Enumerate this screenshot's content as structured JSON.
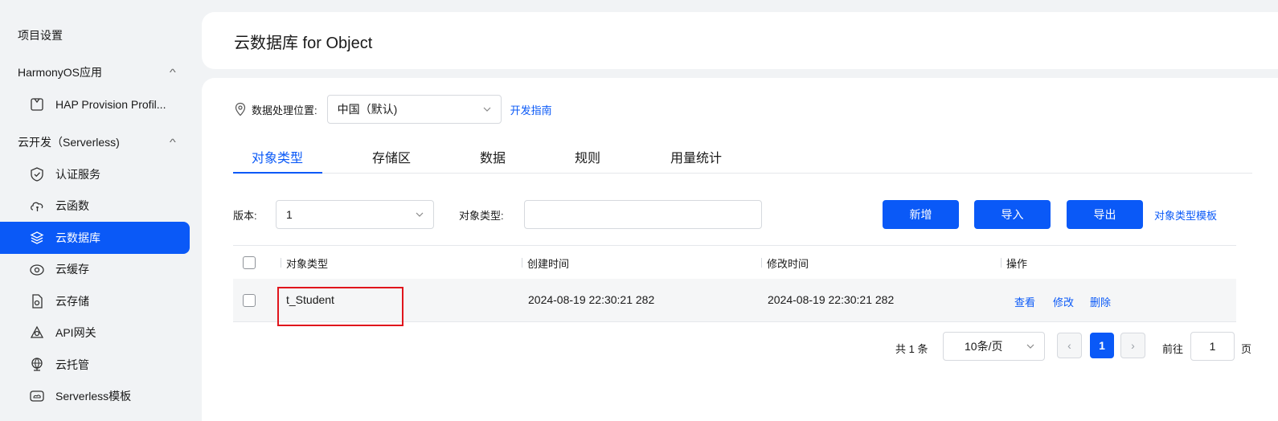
{
  "sidebar": {
    "title": "项目设置",
    "groups": [
      {
        "label": "HarmonyOS应用"
      },
      {
        "label": "云开发（Serverless)"
      }
    ],
    "items": [
      {
        "label": "HAP Provision Profil...",
        "icon": "profile-icon"
      },
      {
        "label": "认证服务",
        "icon": "shield-check-icon"
      },
      {
        "label": "云函数",
        "icon": "cloud-function-icon"
      },
      {
        "label": "云数据库",
        "icon": "database-layers-icon",
        "active": true
      },
      {
        "label": "云缓存",
        "icon": "cloud-cache-icon"
      },
      {
        "label": "云存储",
        "icon": "cloud-storage-icon"
      },
      {
        "label": "API网关",
        "icon": "api-gateway-icon"
      },
      {
        "label": "云托管",
        "icon": "cloud-hosting-icon"
      },
      {
        "label": "Serverless模板",
        "icon": "template-icon"
      }
    ]
  },
  "header": {
    "title": "云数据库 for Object"
  },
  "location": {
    "label": "数据处理位置:",
    "value": "中国（默认)",
    "guide_link": "开发指南"
  },
  "tabs": [
    "对象类型",
    "存储区",
    "数据",
    "规则",
    "用量统计"
  ],
  "filters": {
    "version_label": "版本:",
    "version_value": "1",
    "type_label": "对象类型:",
    "type_value": "",
    "buttons": {
      "add": "新增",
      "import": "导入",
      "export": "导出"
    },
    "template_link": "对象类型模板"
  },
  "table": {
    "columns": [
      "对象类型",
      "创建时间",
      "修改时间",
      "操作"
    ],
    "rows": [
      {
        "type": "t_Student",
        "created": "2024-08-19 22:30:21 282",
        "modified": "2024-08-19 22:30:21 282",
        "actions": [
          "查看",
          "修改",
          "删除"
        ]
      }
    ]
  },
  "pagination": {
    "total": "共 1 条",
    "page_size": "10条/页",
    "current_page": "1",
    "goto_label": "前往",
    "goto_value": "1",
    "page_suffix": "页"
  },
  "colors": {
    "accent": "#0a59f7",
    "highlight_border": "#e0151c"
  }
}
